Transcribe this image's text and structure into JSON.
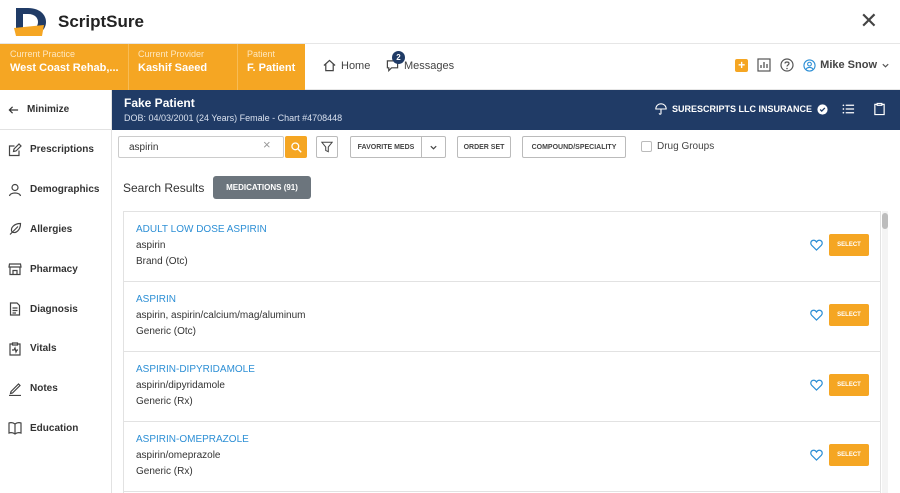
{
  "app": {
    "name": "ScriptSure",
    "close_glyph": "✕"
  },
  "context": {
    "practice_label": "Current Practice",
    "practice_value": "West Coast Rehab,...",
    "provider_label": "Current Provider",
    "provider_value": "Kashif Saeed",
    "patient_label": "Patient",
    "patient_value": "F. Patient"
  },
  "nav": {
    "home_label": "Home",
    "messages_label": "Messages",
    "messages_count": "2"
  },
  "user": {
    "name": "Mike Snow"
  },
  "sidebar": {
    "minimize_label": "Minimize",
    "items": [
      {
        "label": "Prescriptions",
        "icon": "edit-icon"
      },
      {
        "label": "Demographics",
        "icon": "person-icon"
      },
      {
        "label": "Allergies",
        "icon": "feather-icon"
      },
      {
        "label": "Pharmacy",
        "icon": "store-icon"
      },
      {
        "label": "Diagnosis",
        "icon": "document-icon"
      },
      {
        "label": "Vitals",
        "icon": "clipboard-icon"
      },
      {
        "label": "Notes",
        "icon": "pen-icon"
      },
      {
        "label": "Education",
        "icon": "book-icon"
      }
    ]
  },
  "patient": {
    "name": "Fake Patient",
    "details": "DOB: 04/03/2001 (24 Years) Female - Chart #4708448",
    "insurance": "SURESCRIPTS LLC INSURANCE"
  },
  "search": {
    "value": "aspirin",
    "clear_glyph": "×"
  },
  "toolbar": {
    "favorite_meds": "FAVORITE MEDS",
    "order_set": "ORDER SET",
    "compound": "COMPOUND/SPECIALITY",
    "drug_groups": "Drug Groups"
  },
  "results": {
    "title": "Search Results",
    "tab_label": "MEDICATIONS (91)",
    "select_label": "SELECT",
    "items": [
      {
        "name": "ADULT LOW DOSE ASPIRIN",
        "generic": "aspirin",
        "type": "Brand (Otc)"
      },
      {
        "name": "ASPIRIN",
        "generic": "aspirin, aspirin/calcium/mag/aluminum",
        "type": "Generic (Otc)"
      },
      {
        "name": "ASPIRIN-DIPYRIDAMOLE",
        "generic": "aspirin/dipyridamole",
        "type": "Generic (Rx)"
      },
      {
        "name": "ASPIRIN-OMEPRAZOLE",
        "generic": "aspirin/omeprazole",
        "type": "Generic (Rx)"
      }
    ]
  },
  "colors": {
    "accent": "#f5a623",
    "navy": "#203b66",
    "link": "#2d8fd5"
  }
}
